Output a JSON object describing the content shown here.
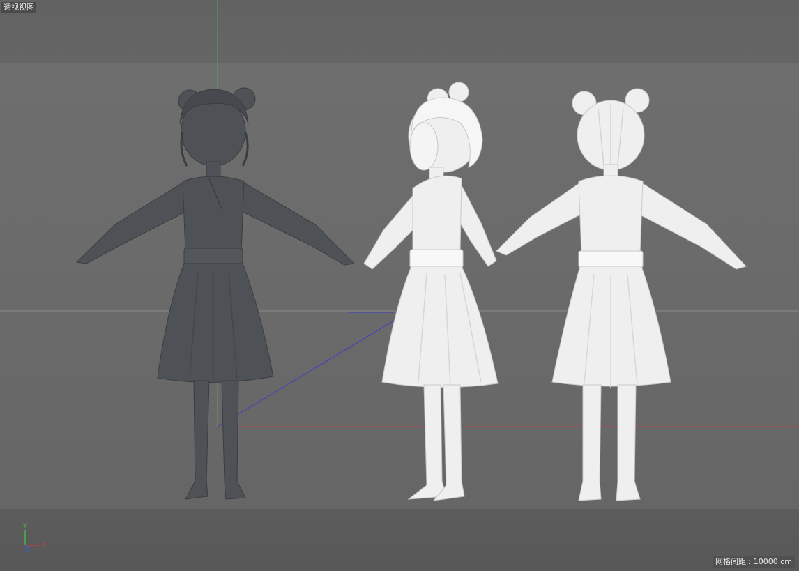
{
  "viewport": {
    "view_label": "透视视图",
    "grid_spacing_label": "网格间距 : ",
    "grid_spacing_value": "10000 cm"
  },
  "axes": {
    "y_label": "Y",
    "x_label": "X",
    "z_label": "Z",
    "colors": {
      "x": "#c83c3c",
      "y": "#4caf50",
      "z": "#3c5ad2"
    }
  },
  "models": [
    {
      "name": "character-dark-front",
      "material": "dark-gray",
      "color": "#4e5256",
      "view": "front"
    },
    {
      "name": "character-white-side",
      "material": "white",
      "color": "#f2f2f2",
      "view": "three-quarter"
    },
    {
      "name": "character-white-back",
      "material": "white",
      "color": "#f2f2f2",
      "view": "back"
    }
  ]
}
